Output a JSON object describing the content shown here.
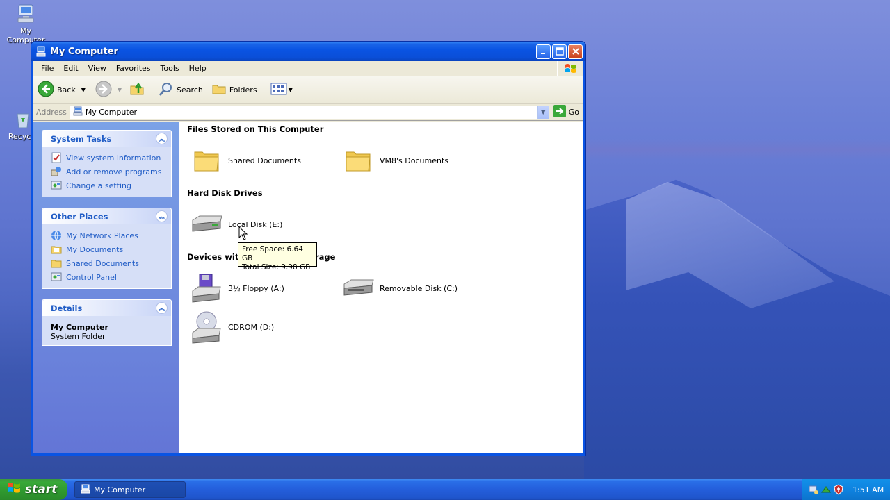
{
  "desktop": {
    "icons": [
      {
        "label": "My Computer"
      },
      {
        "label": "Recycle"
      }
    ]
  },
  "window": {
    "title": "My Computer",
    "menu": [
      "File",
      "Edit",
      "View",
      "Favorites",
      "Tools",
      "Help"
    ],
    "toolbar": {
      "back_label": "Back",
      "search_label": "Search",
      "folders_label": "Folders"
    },
    "address": {
      "label": "Address",
      "value": "My Computer",
      "go_label": "Go"
    },
    "taskpane": {
      "system_tasks": {
        "title": "System Tasks",
        "items": [
          "View system information",
          "Add or remove programs",
          "Change a setting"
        ]
      },
      "other_places": {
        "title": "Other Places",
        "items": [
          "My Network Places",
          "My Documents",
          "Shared Documents",
          "Control Panel"
        ]
      },
      "details": {
        "title": "Details",
        "name": "My Computer",
        "type": "System Folder"
      }
    },
    "groups": {
      "files": {
        "title": "Files Stored on This Computer",
        "items": [
          "Shared Documents",
          "VM8's Documents"
        ]
      },
      "hdd": {
        "title": "Hard Disk Drives",
        "items": [
          "Local Disk (E:)"
        ]
      },
      "removable": {
        "title": "Devices with Removable Storage",
        "items": [
          "3½ Floppy (A:)",
          "Removable Disk (C:)",
          "CDROM (D:)"
        ]
      }
    },
    "tooltip": {
      "free": "Free Space: 6.64 GB",
      "total": "Total Size: 9.98 GB"
    }
  },
  "taskbar": {
    "start_label": "start",
    "task_label": "My Computer",
    "clock": "1:51 AM"
  },
  "icons": {
    "titlebar": "my-computer-icon",
    "windows_flag": "windows-logo-icon"
  }
}
